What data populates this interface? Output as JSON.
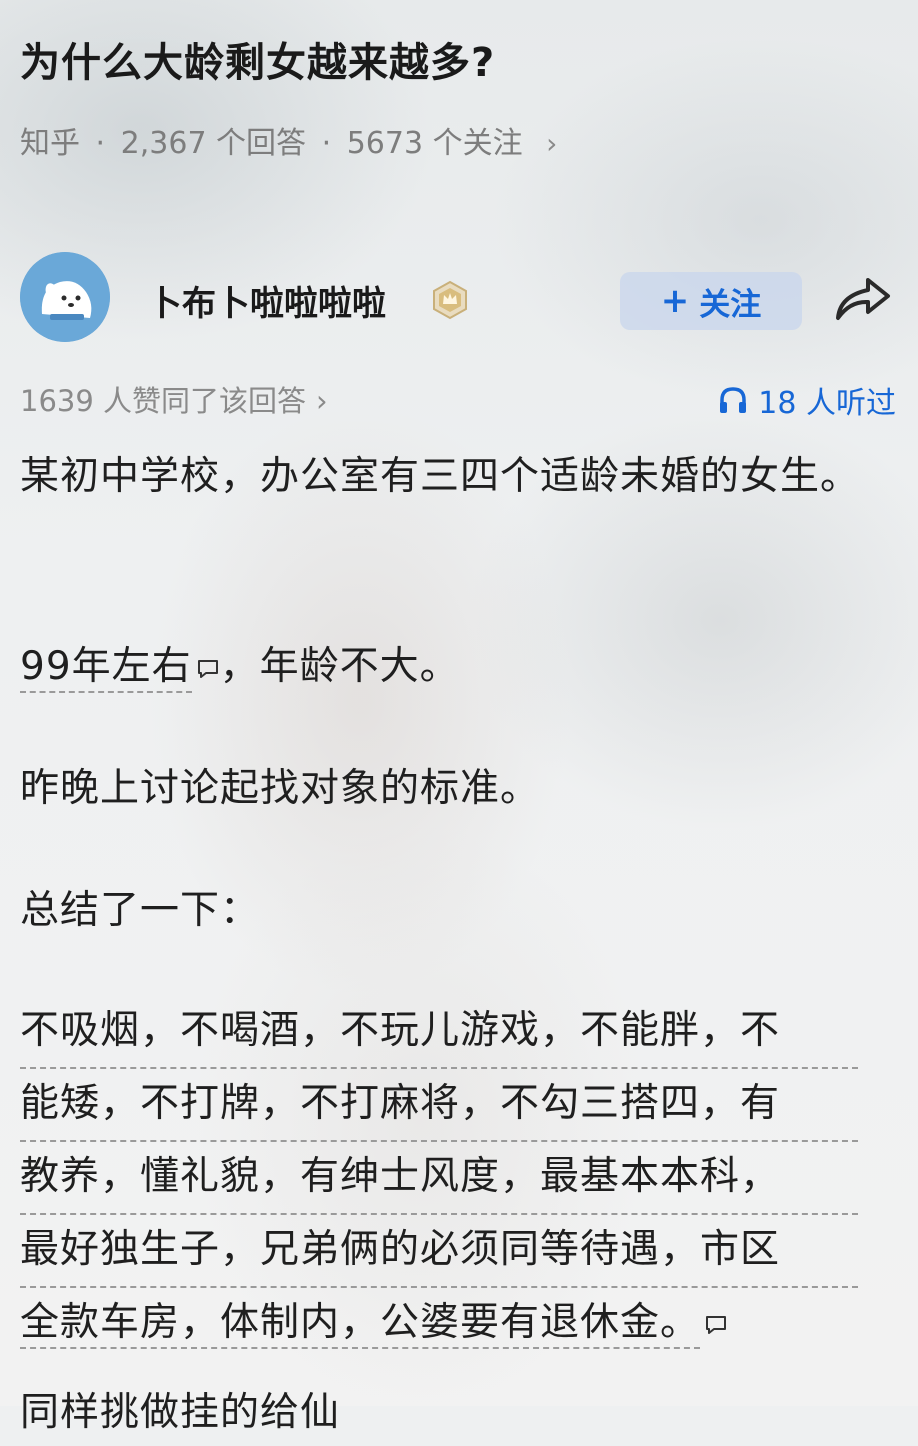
{
  "question": {
    "title": "为什么大龄剩女越来越多?",
    "source": "知乎",
    "answers_text": "2,367 个回答",
    "followers_text": "5673 个关注",
    "separator": "·",
    "chevron": "›"
  },
  "answer": {
    "author_name": "卜布卜啦啦啦啦",
    "follow_label": "关注",
    "follow_plus": "+",
    "agree_text": "1639 人赞同了该回答",
    "agree_chevron": "›",
    "listen_text": "18 人听过"
  },
  "body": {
    "p1": "某初中学校，办公室有三四个适龄未婚的女生。",
    "p2_underlined": "99年左右",
    "p2_rest": "，年龄不大。",
    "p3": "昨晚上讨论起找对象的标准。",
    "p4": "总结了一下：",
    "p5_lines": [
      "不吸烟，不喝酒，不玩儿游戏，不能胖，不",
      "能矮，不打牌，不打麻将，不勾三搭四，有",
      "教养，懂礼貌，有绅士风度，最基本本科，",
      "最好独生子，兄弟俩的必须同等待遇，市区",
      "全款车房，体制内，公婆要有退休金。"
    ],
    "p6_partial": "同样挑做挂的给仙"
  },
  "colors": {
    "accent_blue": "#1767d6",
    "muted_text": "#7d7d7d",
    "follow_bg": "#c8d6ec"
  }
}
